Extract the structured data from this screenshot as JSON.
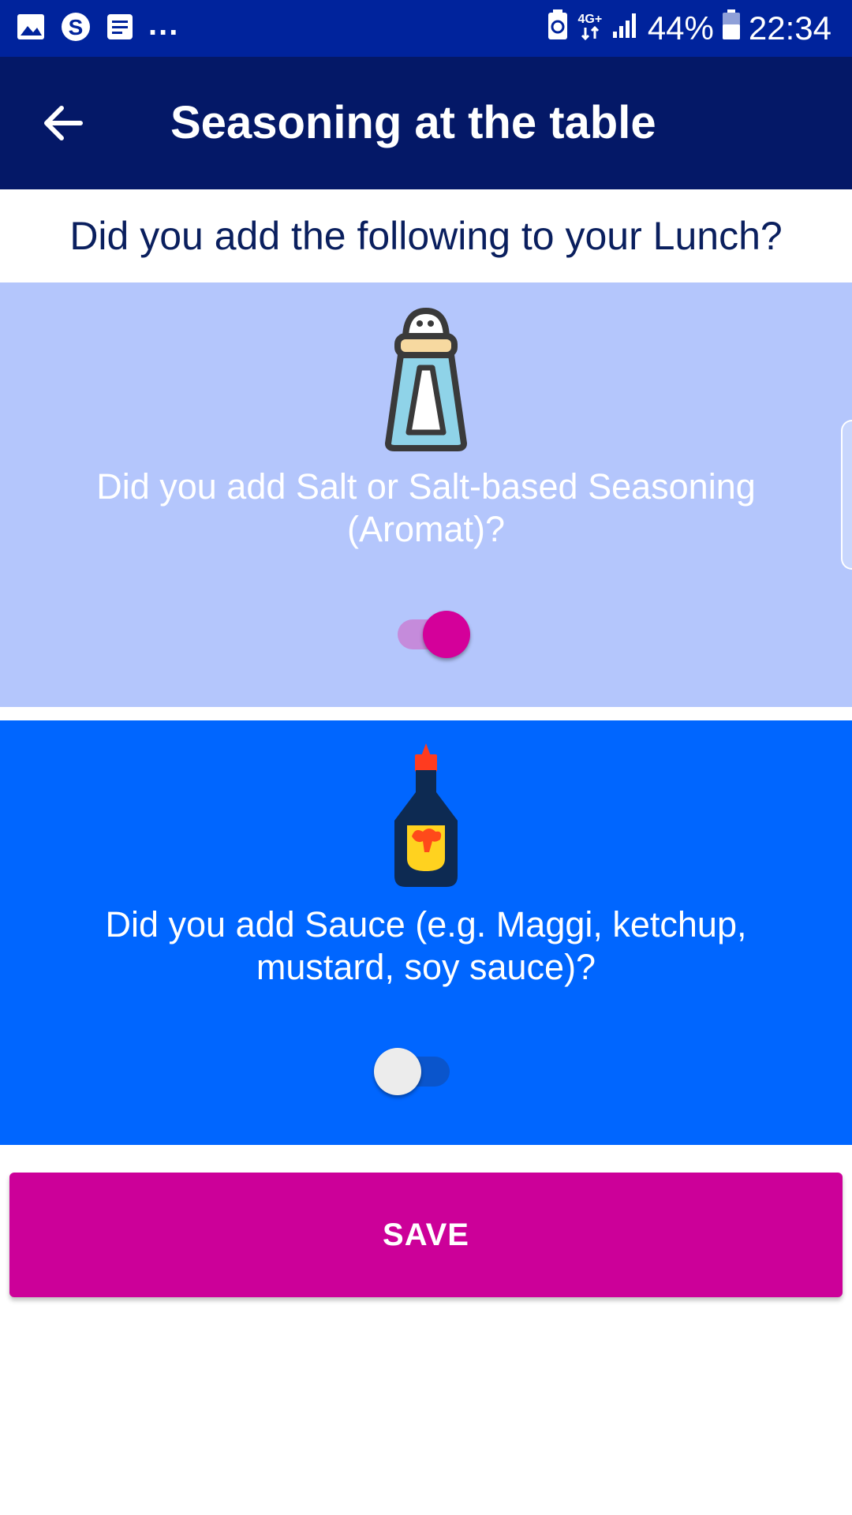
{
  "status_bar": {
    "left_icons": [
      "gallery-icon",
      "skype-icon",
      "notes-icon"
    ],
    "more_indicator": "...",
    "network_label": "4G+",
    "battery_percent": "44%",
    "time": "22:34"
  },
  "app_bar": {
    "back_icon": "arrow-left-icon",
    "title": "Seasoning at the table"
  },
  "question": "Did you add the following to your Lunch?",
  "items": [
    {
      "icon": "salt-shaker-icon",
      "label": "Did you add Salt or Salt-based Seasoning (Aromat)?",
      "checked": true,
      "card_color": "#b4c6fc"
    },
    {
      "icon": "sauce-bottle-icon",
      "label": "Did you add Sauce (e.g. Maggi, ketchup, mustard, soy sauce)?",
      "checked": false,
      "card_color": "#0066ff"
    }
  ],
  "save_label": "SAVE",
  "colors": {
    "status_bar": "#00239c",
    "app_bar": "#041867",
    "accent": "#cc0099",
    "question_text": "#0a1f5e"
  }
}
